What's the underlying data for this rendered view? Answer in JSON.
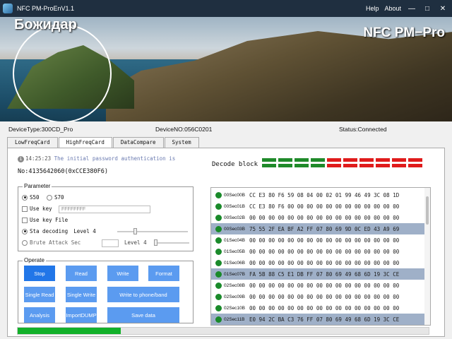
{
  "window": {
    "title": "NFC PM-ProEnV1.1",
    "help": "Help",
    "about": "About"
  },
  "banner": {
    "name": "Божидар",
    "brand": "NFC PM−Pro"
  },
  "info": {
    "device_type": "DeviceType:300CD_Pro",
    "device_no": "DeviceNO:056C0201",
    "status": "Status:Connected"
  },
  "tabs": [
    {
      "label": "LowFreqCard"
    },
    {
      "label": "HighFreqCard"
    },
    {
      "label": "DataCompare"
    },
    {
      "label": "System"
    }
  ],
  "active_tab": "HighFreqCard",
  "log": {
    "time": "14:25:23",
    "message": "The initial password authentication is",
    "card_no": "No:4135642060(0xCCE380F6)"
  },
  "decode": {
    "label": "Decode block",
    "blocks": [
      "#1f8a2a",
      "#1f8a2a",
      "#1f8a2a",
      "#1f8a2a",
      "#e01b1b",
      "#e01b1b",
      "#e01b1b",
      "#e01b1b",
      "#e01b1b",
      "#e01b1b",
      "#1f8a2a",
      "#1f8a2a",
      "#1f8a2a",
      "#1f8a2a",
      "#e01b1b",
      "#e01b1b",
      "#e01b1b",
      "#e01b1b",
      "#e01b1b",
      "#e01b1b"
    ]
  },
  "parameter": {
    "title": "Parameter",
    "s50": "S50",
    "s70": "S70",
    "use_key": "Use key",
    "key_value": "FFFFFFFF",
    "use_key_file": "Use key File",
    "sta_decoding": "Sta decoding",
    "level_a": "Level 4",
    "brute": "Brute Attack Sec",
    "level_b": "Level 4"
  },
  "operate": {
    "title": "Operate",
    "stop": "Stop",
    "read": "Read",
    "write": "Write",
    "format": "Format",
    "single_read": "Single Read",
    "single_write": "Single Write",
    "write_phone": "Write to phone/band",
    "analysis": "Analysis",
    "import_dump": "ImportDUMP",
    "save_data": "Save data"
  },
  "sectors": [
    {
      "name": "00Sec00B",
      "hex": "CC E3 80 F6 59 08 04 00 02 01 99 46 49 3C 08 1D",
      "hl": false
    },
    {
      "name": "00Sec01B",
      "hex": "CC E3 80 F6 00 00 00 00 00 00 00 00 00 00 00 00",
      "hl": false
    },
    {
      "name": "00Sec02B",
      "hex": "00 00 00 00 00 00 00 00 00 00 00 00 00 00 00 00",
      "hl": false
    },
    {
      "name": "00Sec03B",
      "hex": "75 55 2F EA BF A2 FF 07 80 69 9D 0C ED 43 A9 69",
      "hl": true
    },
    {
      "name": "01Sec04B",
      "hex": "00 00 00 00 00 00 00 00 00 00 00 00 00 00 00 00",
      "hl": false
    },
    {
      "name": "01Sec05B",
      "hex": "00 00 00 00 00 00 00 00 00 00 00 00 00 00 00 00",
      "hl": false
    },
    {
      "name": "01Sec06B",
      "hex": "00 00 00 00 00 00 00 00 00 00 00 00 00 00 00 00",
      "hl": false
    },
    {
      "name": "01Sec07B",
      "hex": "FA 5B 88 C5 E1 DB FF 07 80 69 49 68 6D 19 3C CE",
      "hl": true
    },
    {
      "name": "02Sec08B",
      "hex": "00 00 00 00 00 00 00 00 00 00 00 00 00 00 00 00",
      "hl": false
    },
    {
      "name": "02Sec09B",
      "hex": "00 00 00 00 00 00 00 00 00 00 00 00 00 00 00 00",
      "hl": false
    },
    {
      "name": "02Sec10B",
      "hex": "00 00 00 00 00 00 00 00 00 00 00 00 00 00 00 00",
      "hl": false
    },
    {
      "name": "02Sec11B",
      "hex": "E0 94 2C BA C3 76 FF 07 80 69 49 68 6D 19 3C CE",
      "hl": true
    }
  ],
  "progress": 0.25
}
